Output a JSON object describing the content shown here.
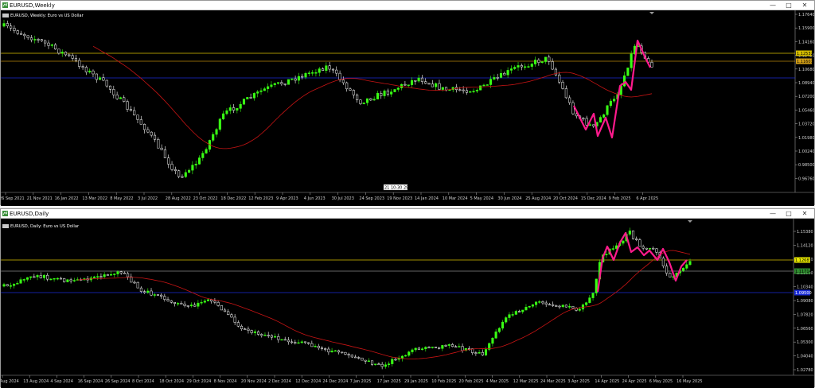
{
  "top": {
    "window_title": "EURUSD,Weekly",
    "chart_label": "EURUSD, Weekly:  Euro vs US Dollar",
    "price_ticks": [
      "1.17640",
      "1.15900",
      "1.14160",
      "1.12420",
      "1.10680",
      "1.08940",
      "1.07200",
      "1.05460",
      "1.03720",
      "1.01980",
      "1.00240",
      "0.98500",
      "0.96760"
    ],
    "price_tag_yellow": "1.12532",
    "price_tag_orange": "1.11607",
    "date_ticks": [
      "26 Sep 2021",
      "21 Nov 2021",
      "16 Jan 2022",
      "13 Mar 2022",
      "8 May 2022",
      "3 Jul 2022",
      "28 Aug 2022",
      "23 Oct 2022",
      "18 Dec 2022",
      "12 Feb 2023",
      "9 Apr 2023",
      "4 Jun 2023",
      "30 Jul 2023",
      "24 Sep 2023",
      "19 Nov 2023",
      "14 Jan 2024",
      "10 Mar 2024",
      "5 May 2024",
      "30 Jun 2024",
      "25 Aug 2024",
      "20 Oct 2024",
      "15 Dec 2024",
      "9 Feb 2025",
      "6 Apr 2025"
    ],
    "crosshair_label": "21 10:30  29:00"
  },
  "bottom": {
    "window_title": "EURUSD,Daily",
    "chart_label": "EURUSD, Daily:  Euro vs US Dollar",
    "price_ticks": [
      "1.15380",
      "1.14120",
      "1.12860",
      "1.11600",
      "1.10340",
      "1.09080",
      "1.07820",
      "1.06560",
      "1.05300",
      "1.04040",
      "1.02780"
    ],
    "price_tag_yellow": "1.12683",
    "price_tag_green": "1.11714",
    "price_tag_blue": "1.09500",
    "date_ticks": [
      "2 Aug 2024",
      "13 Aug 2024",
      "4 Sep 2024",
      "16 Sep 2024",
      "26 Sep 2024",
      "8 Oct 2024",
      "18 Oct 2024",
      "29 Oct 2024",
      "8 Nov 2024",
      "20 Nov 2024",
      "2 Dec 2024",
      "12 Dec 2024",
      "24 Dec 2024",
      "7 Jan 2025",
      "17 Jan 2025",
      "29 Jan 2025",
      "10 Feb 2025",
      "20 Feb 2025",
      "4 Mar 2025",
      "12 Mar 2025",
      "24 Mar 2025",
      "3 Apr 2025",
      "14 Apr 2025",
      "24 Apr 2025",
      "6 May 2025",
      "16 May 2025"
    ]
  },
  "colors": {
    "bull": "#39ff14",
    "bear": "#ffffff",
    "ma": "#c81414",
    "zigzag": "#ff1a8c",
    "yellow_line": "#d9c000",
    "blue_line": "#1a2bd6",
    "green_line": "#2e8b2e"
  },
  "icons": {
    "window_minimize": "minimize-icon",
    "window_maximize": "maximize-icon",
    "window_close": "close-icon"
  }
}
